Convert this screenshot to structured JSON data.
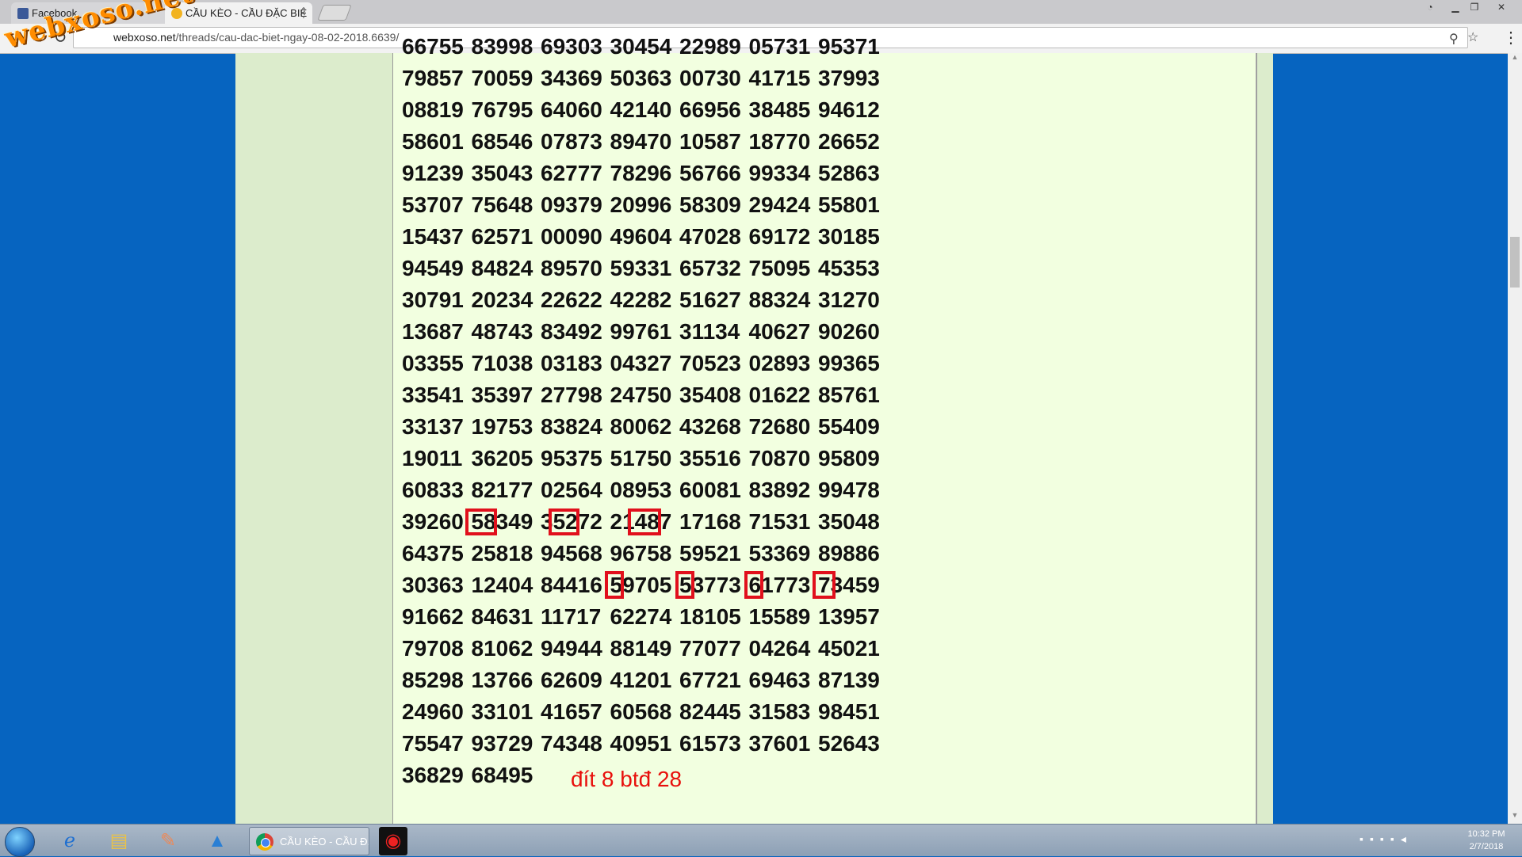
{
  "browser": {
    "tabs": [
      {
        "label": "Facebook"
      },
      {
        "label": "CẦU KÈO - CẦU ĐẶC BIỆ"
      }
    ],
    "tab_close": "×",
    "url_host": "webxoso.net",
    "url_path": "/threads/cau-dac-biet-ngay-08-02-2018.6639/",
    "icons": [
      "back-icon",
      "forward-icon",
      "reload-icon",
      "zoom-icon",
      "star-icon",
      "menu-icon"
    ]
  },
  "watermark": "webxoso.net",
  "post": {
    "rows": [
      [
        "66755",
        "83998",
        "69303",
        "30454",
        "22989",
        "05731",
        "95371"
      ],
      [
        "79857",
        "70059",
        "34369",
        "50363",
        "00730",
        "41715",
        "37993"
      ],
      [
        "08819",
        "76795",
        "64060",
        "42140",
        "66956",
        "38485",
        "94612"
      ],
      [
        "58601",
        "68546",
        "07873",
        "89470",
        "10587",
        "18770",
        "26652"
      ],
      [
        "91239",
        "35043",
        "62777",
        "78296",
        "56766",
        "99334",
        "52863"
      ],
      [
        "53707",
        "75648",
        "09379",
        "20996",
        "58309",
        "29424",
        "55801"
      ],
      [
        "15437",
        "62571",
        "00090",
        "49604",
        "47028",
        "69172",
        "30185"
      ],
      [
        "94549",
        "84824",
        "89570",
        "59331",
        "65732",
        "75095",
        "45353"
      ],
      [
        "30791",
        "20234",
        "22622",
        "42282",
        "51627",
        "88324",
        "31270"
      ],
      [
        "13687",
        "48743",
        "83492",
        "99761",
        "31134",
        "40627",
        "90260"
      ],
      [
        "03355",
        "71038",
        "03183",
        "04327",
        "70523",
        "02893",
        "99365"
      ],
      [
        "33541",
        "35397",
        "27798",
        "24750",
        "35408",
        "01622",
        "85761"
      ],
      [
        "33137",
        "19753",
        "83824",
        "80062",
        "43268",
        "72680",
        "55409"
      ],
      [
        "19011",
        "36205",
        "95375",
        "51750",
        "35516",
        "70870",
        "95809"
      ],
      [
        "60833",
        "82177",
        "02564",
        "08953",
        "60081",
        "83892",
        "99478"
      ],
      [
        "39260",
        "58349",
        "35272",
        "21487",
        "17168",
        "71531",
        "35048"
      ],
      [
        "64375",
        "25818",
        "94568",
        "96758",
        "59521",
        "53369",
        "89886"
      ],
      [
        "30363",
        "12404",
        "84416",
        "59705",
        "53773",
        "61773",
        "73459"
      ],
      [
        "91662",
        "84631",
        "11717",
        "62274",
        "18105",
        "15589",
        "13957"
      ],
      [
        "79708",
        "81062",
        "94944",
        "88149",
        "77077",
        "04264",
        "45021"
      ],
      [
        "85298",
        "13766",
        "62609",
        "41201",
        "67721",
        "69463",
        "87139"
      ],
      [
        "24960",
        "33101",
        "41657",
        "60568",
        "82445",
        "31583",
        "98451"
      ],
      [
        "75547",
        "93729",
        "74348",
        "40951",
        "61573",
        "37601",
        "52643"
      ],
      [
        "36829",
        "68495"
      ]
    ],
    "note": "đít 8 btđ 28"
  },
  "taskbar": {
    "chrome_label": "CẦU KÈO - CẦU Đ...",
    "clock_time": "10:32 PM",
    "clock_date": "2/7/2018",
    "icons": [
      "start-orb-icon",
      "internet-explorer-icon",
      "file-explorer-icon",
      "paint-icon",
      "app-drop-icon",
      "chrome-icon",
      "game-app-icon"
    ]
  }
}
